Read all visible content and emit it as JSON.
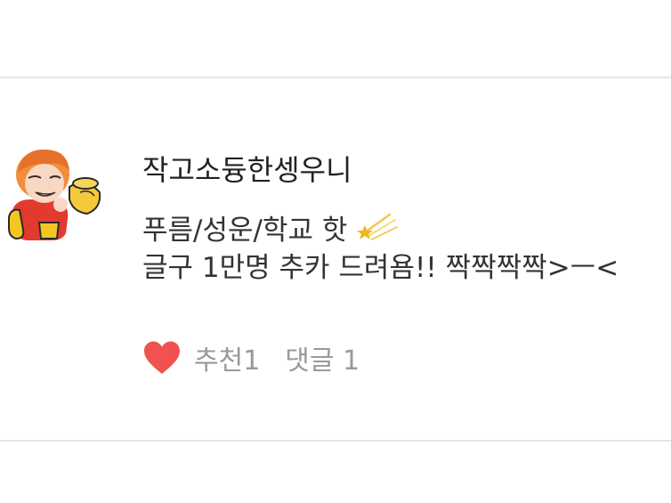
{
  "post": {
    "author": "작고소듕한셍우니",
    "message_line1": "푸름/성운/학교   핫",
    "message_line2": "글구 1만명 추카 드려욤!! 짝짝짝짝>ㅡ<",
    "actions": {
      "like_label": "추천1",
      "comment_label": "댓글 1"
    }
  },
  "colors": {
    "heart": "#f0524f",
    "divider": "#e6e6e6",
    "action_text": "#999999"
  },
  "icons": {
    "like": "heart-icon",
    "emoji": "shooting-star-icon",
    "avatar": "avatar-sticker"
  }
}
